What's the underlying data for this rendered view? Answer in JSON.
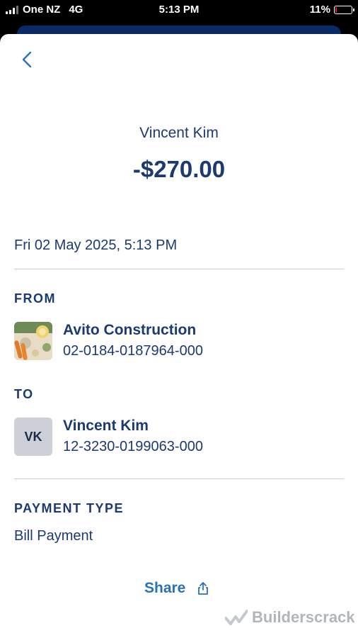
{
  "status_bar": {
    "carrier": "One NZ",
    "network": "4G",
    "time": "5:13 PM",
    "battery": "11%",
    "battery_level": 0.11
  },
  "header": {
    "back_icon": "chevron-left-icon",
    "payee_name": "Vincent Kim",
    "amount": "-$270.00"
  },
  "transaction": {
    "datetime": "Fri 02 May 2025, 5:13 PM"
  },
  "from": {
    "label": "FROM",
    "name": "Avito Construction",
    "account": "02-0184-0187964-000"
  },
  "to": {
    "label": "TO",
    "initials": "VK",
    "name": "Vincent Kim",
    "account": "12-3230-0199063-000"
  },
  "payment": {
    "label": "PAYMENT TYPE",
    "type": "Bill Payment"
  },
  "actions": {
    "share_label": "Share",
    "share_icon": "share-icon"
  },
  "watermark": {
    "text": "Builderscrack"
  },
  "colors": {
    "primary_text": "#1b3a72",
    "link": "#2a72b8",
    "divider": "#c8ccd4"
  }
}
